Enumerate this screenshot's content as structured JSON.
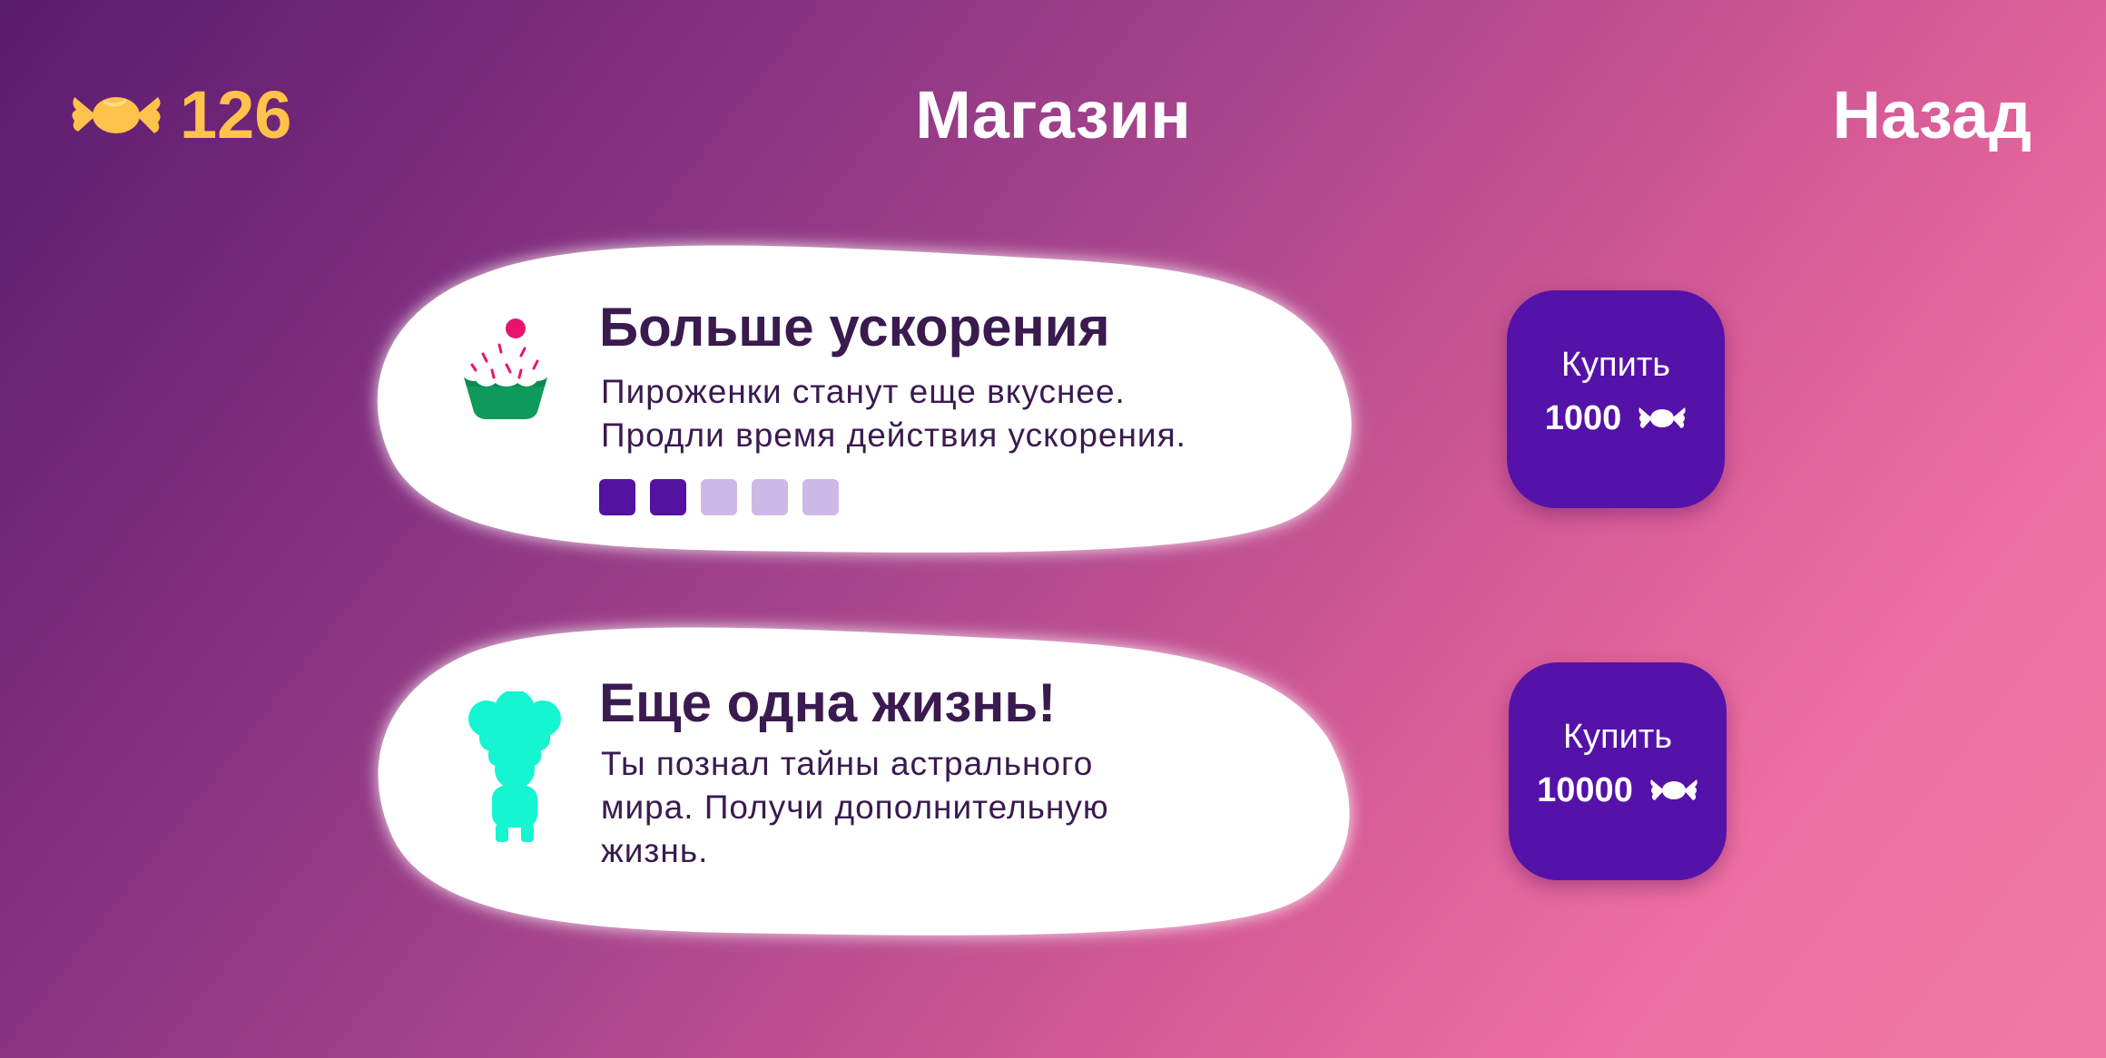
{
  "header": {
    "candy_count": "126",
    "title": "Магазин",
    "back_label": "Назад"
  },
  "items": [
    {
      "title": "Больше ускорения",
      "description_lines": [
        "Пироженки станут еще вкуснее.",
        "Продли время действия ускорения."
      ],
      "icon": "cupcake-icon",
      "level": 2,
      "level_max": 5,
      "buy_label": "Купить",
      "price": "1000"
    },
    {
      "title": "Еще одна жизнь!",
      "description_lines": [
        "Ты познал тайны астрального",
        "мира. Получи дополнительную",
        "жизнь."
      ],
      "icon": "chef-silhouette-icon",
      "buy_label": "Купить",
      "price": "10000"
    }
  ],
  "colors": {
    "candy_gold": "#ffc24b",
    "button_purple": "#5512a8",
    "dot_filled": "#5312a0",
    "dot_empty": "#cdb9e5",
    "text_dark": "#3a1a4f",
    "chef_cyan": "#14f5d0"
  }
}
